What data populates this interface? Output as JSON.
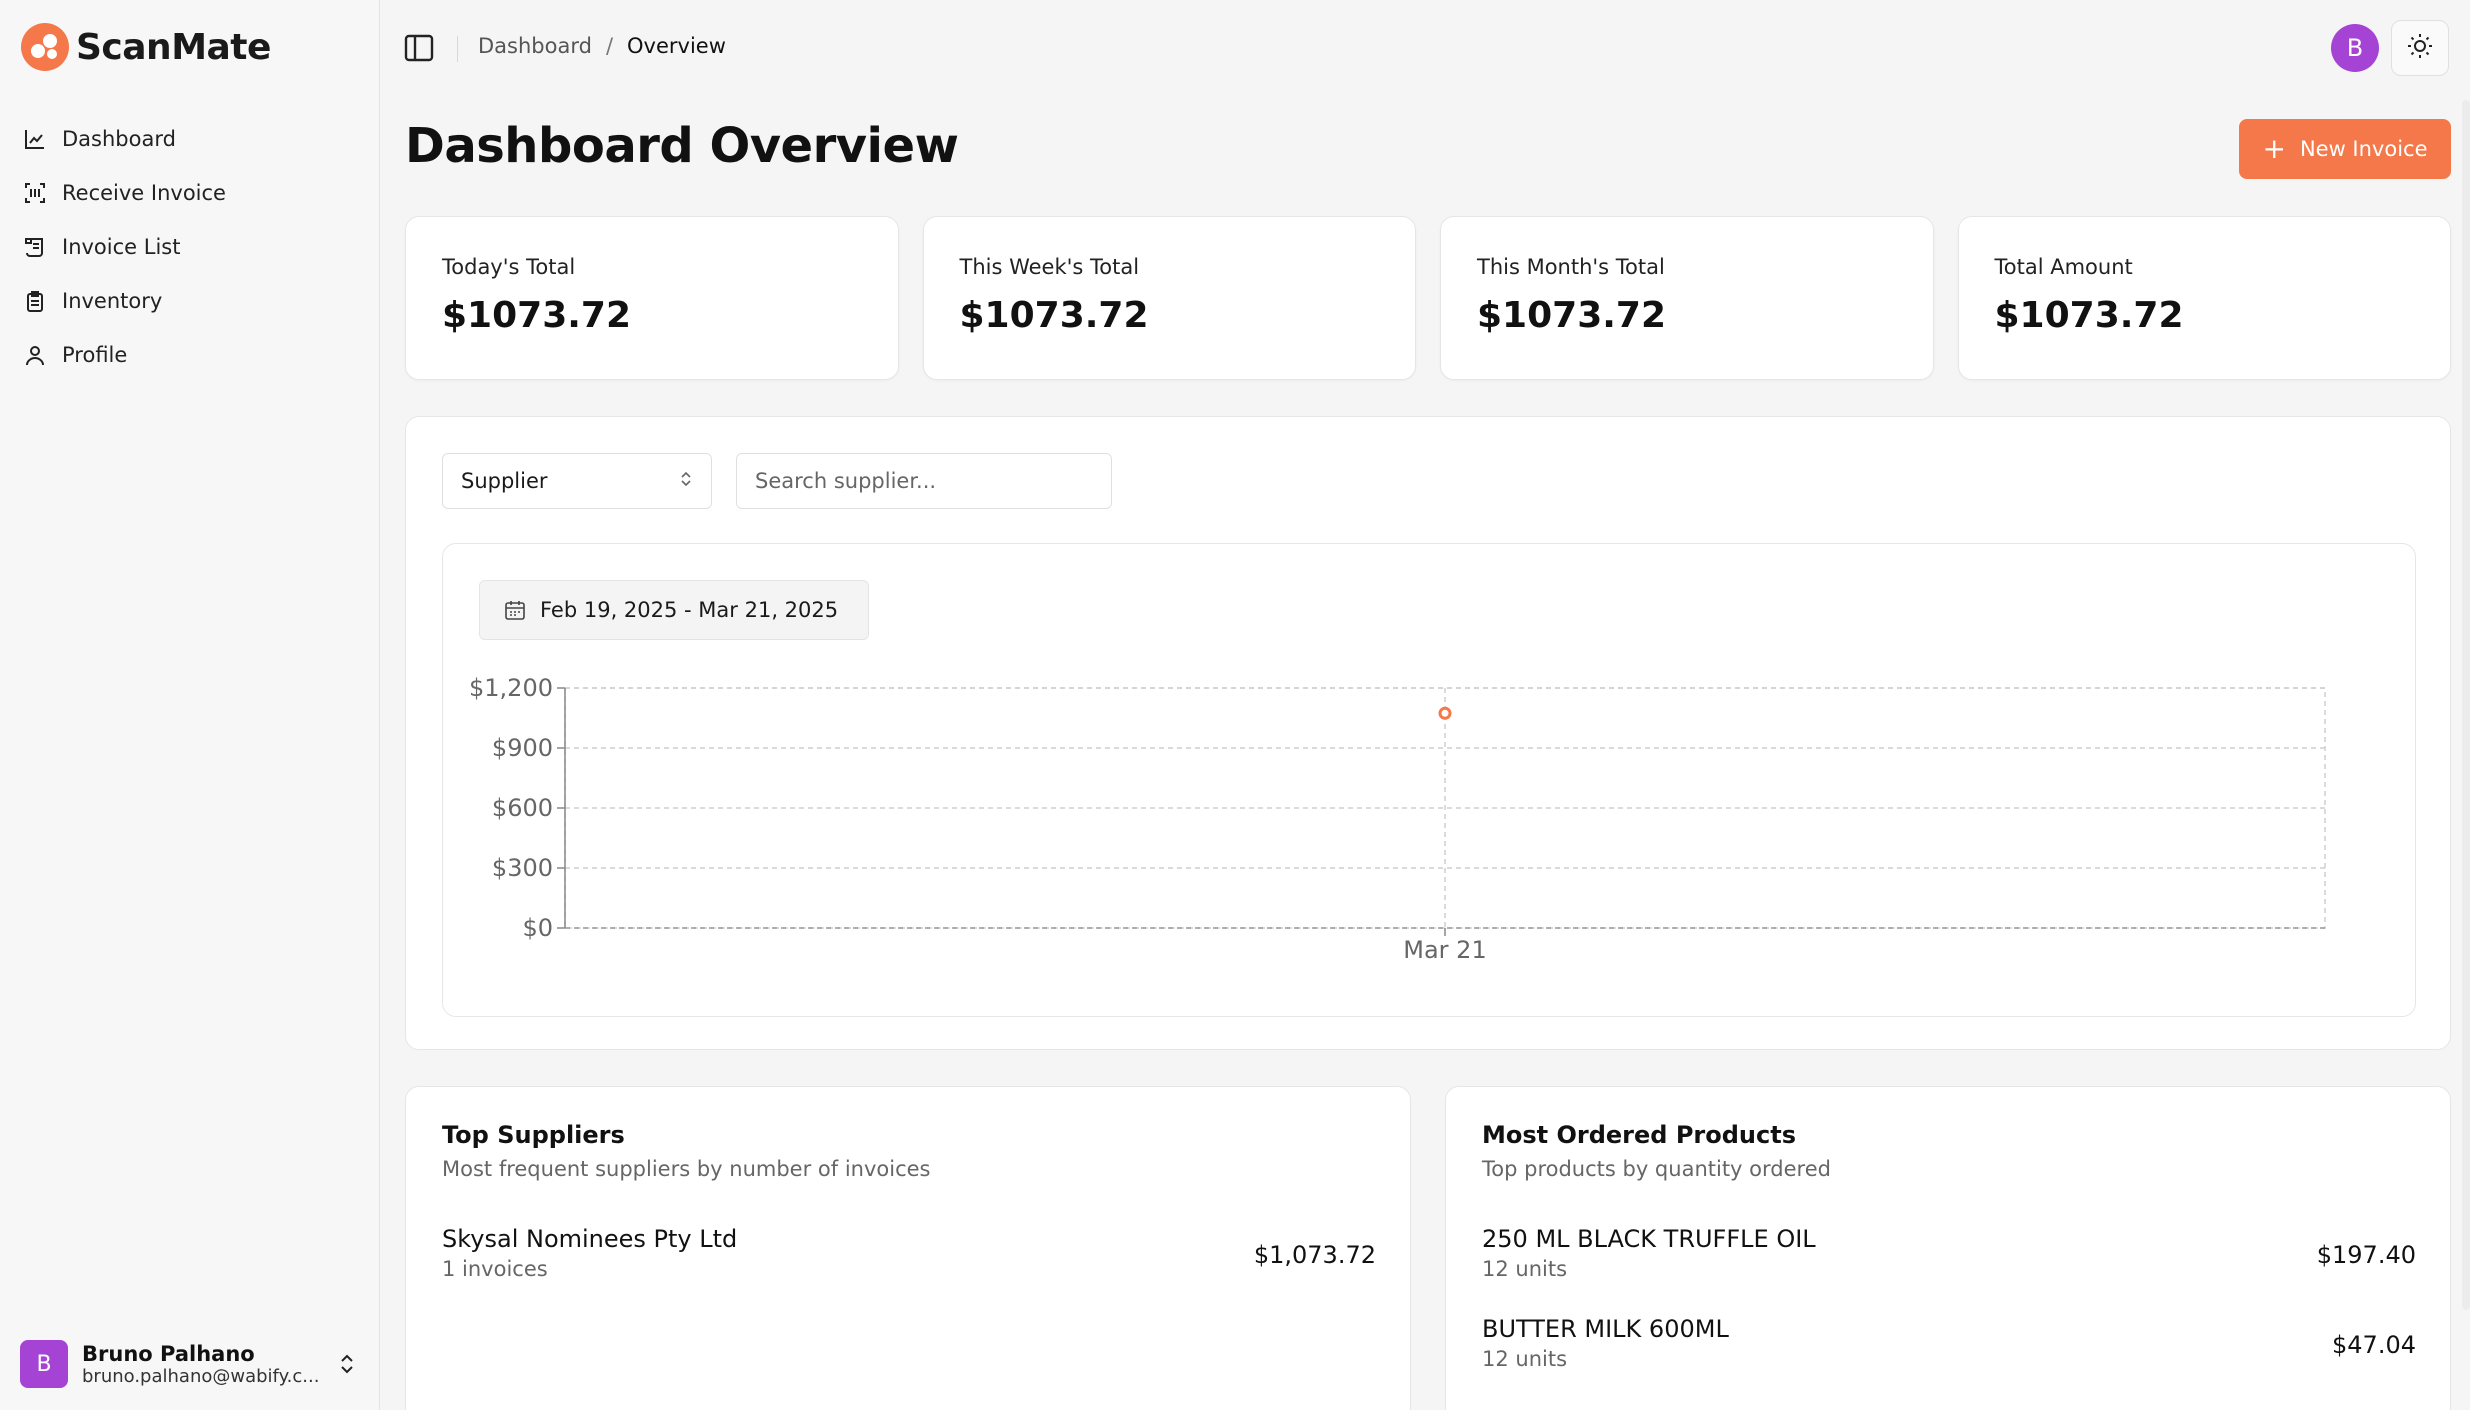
{
  "app": {
    "name": "ScanMate"
  },
  "sidebar": {
    "items": [
      {
        "label": "Dashboard",
        "icon": "chart-line-icon"
      },
      {
        "label": "Receive Invoice",
        "icon": "scan-icon"
      },
      {
        "label": "Invoice List",
        "icon": "scroll-icon"
      },
      {
        "label": "Inventory",
        "icon": "clipboard-icon"
      },
      {
        "label": "Profile",
        "icon": "user-icon"
      }
    ],
    "user": {
      "initial": "B",
      "name": "Bruno Palhano",
      "email": "bruno.palhano@wabify.c..."
    }
  },
  "topbar": {
    "breadcrumb": [
      "Dashboard",
      "Overview"
    ],
    "separator": "/",
    "avatar_initial": "B"
  },
  "page": {
    "title": "Dashboard Overview",
    "new_button": "New Invoice"
  },
  "stats": [
    {
      "label": "Today's Total",
      "value": "$1073.72"
    },
    {
      "label": "This Week's Total",
      "value": "$1073.72"
    },
    {
      "label": "This Month's Total",
      "value": "$1073.72"
    },
    {
      "label": "Total Amount",
      "value": "$1073.72"
    }
  ],
  "filters": {
    "supplier_select": "Supplier",
    "search_placeholder": "Search supplier..."
  },
  "date_range": "Feb 19, 2025 - Mar 21, 2025",
  "chart_data": {
    "type": "line",
    "x": [
      "Mar 21"
    ],
    "series": [
      {
        "values": [
          1073.72
        ]
      }
    ],
    "ylim": [
      0,
      1200
    ],
    "yticks": [
      "$0",
      "$300",
      "$600",
      "$900",
      "$1,200"
    ],
    "ytick_values": [
      0,
      300,
      600,
      900,
      1200
    ],
    "grid": true,
    "color": "#f4784a"
  },
  "top_suppliers": {
    "title": "Top Suppliers",
    "subtitle": "Most frequent suppliers by number of invoices",
    "rows": [
      {
        "name": "Skysal Nominees Pty Ltd",
        "meta": "1 invoices",
        "amount": "$1,073.72"
      }
    ]
  },
  "most_ordered": {
    "title": "Most Ordered Products",
    "subtitle": "Top products by quantity ordered",
    "rows": [
      {
        "name": "250 ML BLACK TRUFFLE OIL",
        "meta": "12 units",
        "amount": "$197.40"
      },
      {
        "name": "BUTTER MILK 600ML",
        "meta": "12 units",
        "amount": "$47.04"
      }
    ]
  },
  "colors": {
    "accent": "#f4784a",
    "avatar": "#a544d4"
  }
}
